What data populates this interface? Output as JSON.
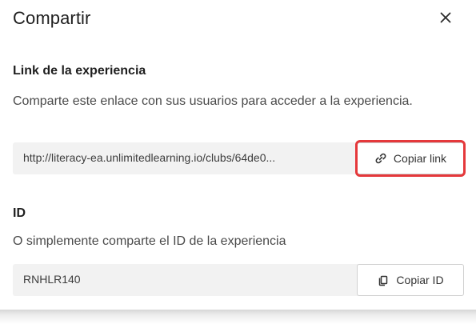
{
  "dialog": {
    "title": "Compartir",
    "close_icon": "close-icon"
  },
  "link_section": {
    "heading": "Link de la experiencia",
    "description": "Comparte este enlace con sus usuarios para acceder a la experiencia.",
    "url_value": "http://literacy-ea.unlimitedlearning.io/clubs/64de0...",
    "copy_button_label": "Copiar link",
    "copy_icon": "link-icon"
  },
  "id_section": {
    "heading": "ID",
    "description": "O simplemente comparte el ID de la experiencia",
    "id_value": "RNHLR140",
    "copy_button_label": "Copiar ID",
    "copy_icon": "copy-icon"
  },
  "colors": {
    "highlight": "#e5383b",
    "field_background": "#f2f2f2",
    "text_primary": "#1f1f1f",
    "text_secondary": "#4a4a4a"
  }
}
